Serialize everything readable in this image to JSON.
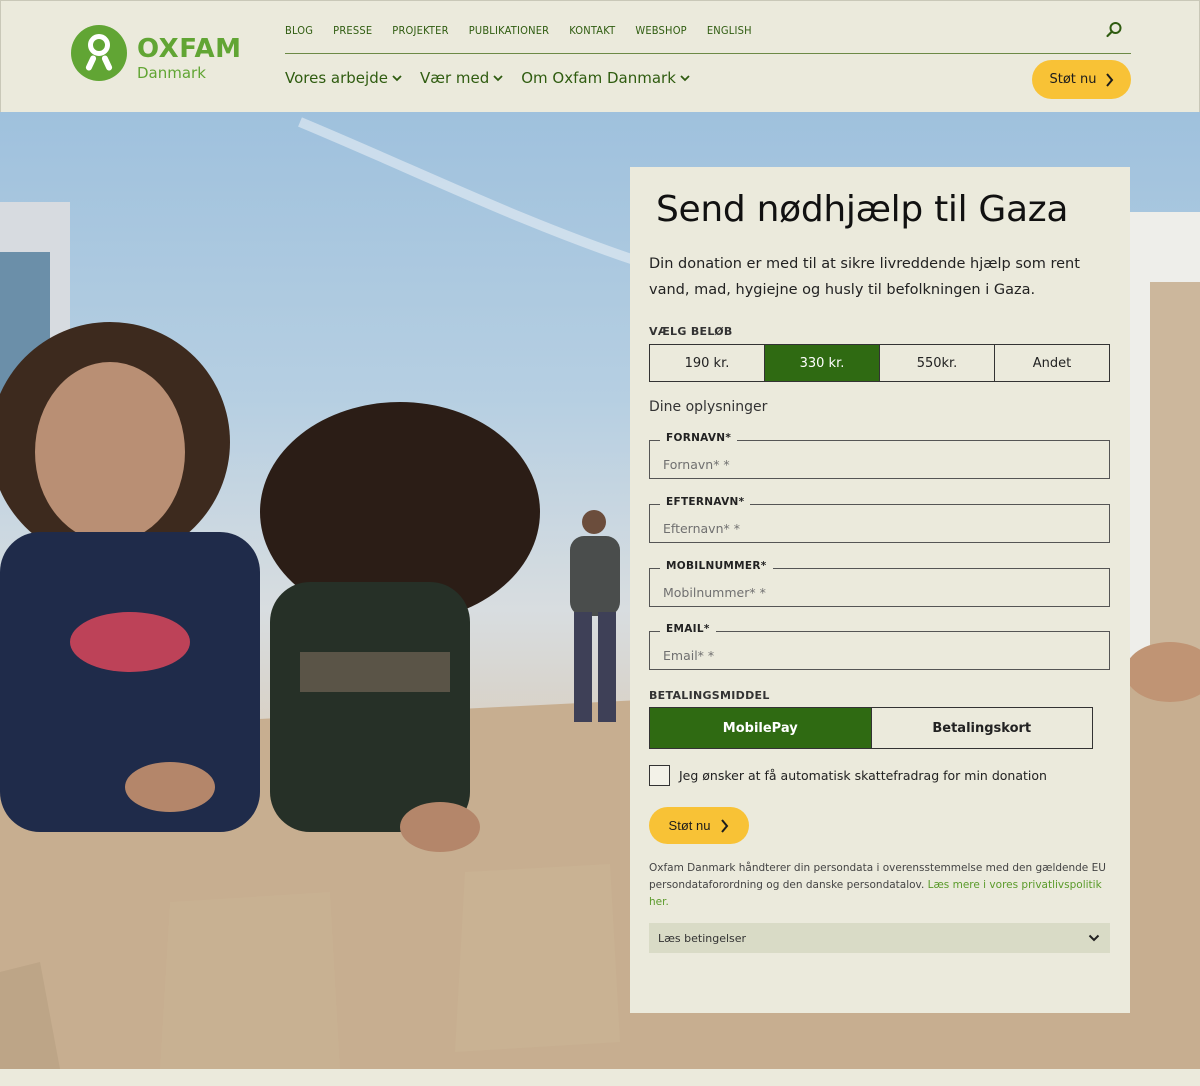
{
  "header": {
    "logo_brand": "OXFAM",
    "logo_country": "Danmark",
    "top_links": [
      "BLOG",
      "PRESSE",
      "PROJEKTER",
      "PUBLIKATIONER",
      "KONTAKT",
      "WEBSHOP",
      "ENGLISH"
    ],
    "main_nav": [
      "Vores arbejde",
      "Vær med",
      "Om Oxfam Danmark"
    ],
    "support_button": "Støt nu",
    "search_icon": "search-icon",
    "brand_color": "#61a534",
    "accent_color": "#f8c236"
  },
  "form": {
    "title": "Send nødhjælp til Gaza",
    "intro": "Din donation er med til at sikre livreddende hjælp som rent vand, mad, hygiejne og husly til befolkningen i Gaza.",
    "amount_label": "VÆLG BELØB",
    "amounts": [
      "190 kr.",
      "330 kr.",
      "550kr.",
      "Andet"
    ],
    "selected_amount": "330 kr.",
    "details_title": "Dine oplysninger",
    "fields": [
      {
        "label": "FORNAVN*",
        "placeholder": "Fornavn* *"
      },
      {
        "label": "EFTERNAVN*",
        "placeholder": "Efternavn* *"
      },
      {
        "label": "MOBILNUMMER*",
        "placeholder": "Mobilnummer* *"
      },
      {
        "label": "EMAIL*",
        "placeholder": "Email* *"
      }
    ],
    "payment_label": "BETALINGSMIDDEL",
    "payment_options": [
      "MobilePay",
      "Betalingskort"
    ],
    "selected_payment": "MobilePay",
    "tax_checkbox": "Jeg ønsker at få automatisk skattefradrag for min donation",
    "submit": "Støt nu",
    "privacy_text": "Oxfam Danmark håndterer din persondata i overensstemmelse med den gældende EU persondataforordning og den danske persondatalov.",
    "privacy_link": "Læs mere i vores privatlivspolitik her.",
    "terms": "Læs betingelser",
    "selected_color": "#2f6a12"
  }
}
